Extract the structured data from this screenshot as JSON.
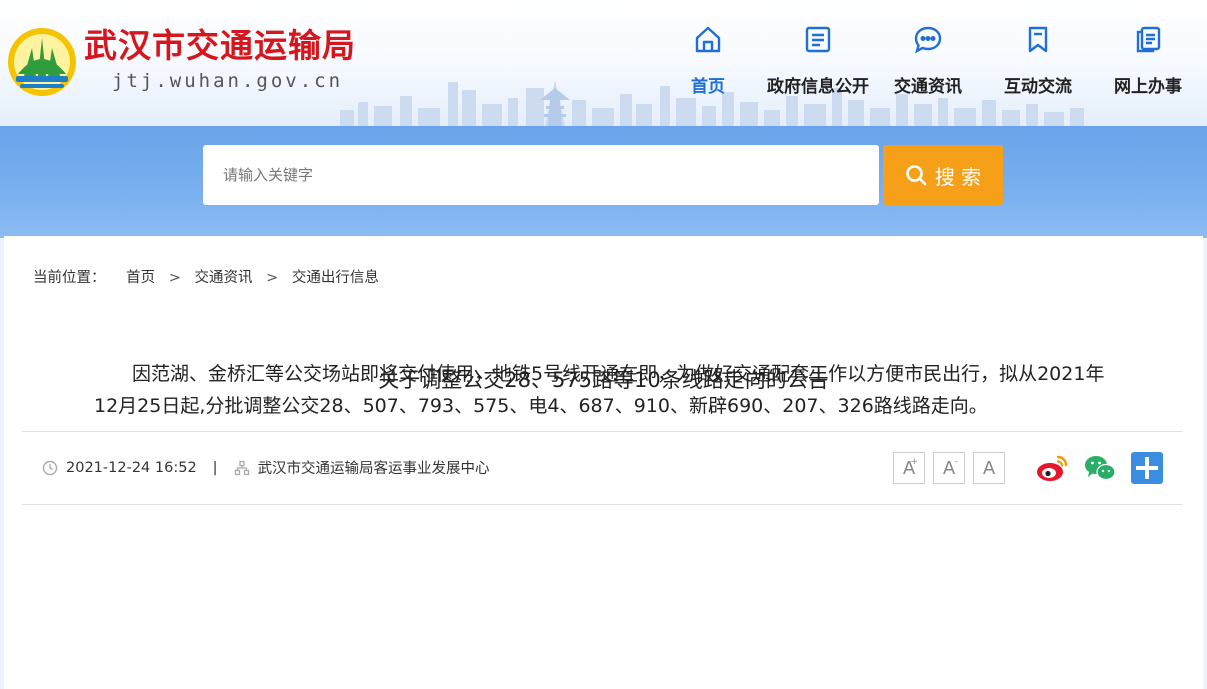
{
  "header": {
    "site_title": "武汉市交通运输局",
    "site_domain": "jtj.wuhan.gov.cn",
    "nav": [
      {
        "label": "首页",
        "icon": "home-icon",
        "active": true
      },
      {
        "label": "政府信息公开",
        "icon": "document-list-icon",
        "active": false
      },
      {
        "label": "交通资讯",
        "icon": "chat-bubble-icon",
        "active": false
      },
      {
        "label": "互动交流",
        "icon": "bookmark-icon",
        "active": false
      },
      {
        "label": "网上办事",
        "icon": "files-icon",
        "active": false
      }
    ]
  },
  "search": {
    "placeholder": "请输入关键字",
    "button_label": "搜 索"
  },
  "breadcrumb": {
    "prefix": "当前位置：",
    "items": [
      "首页",
      "交通资讯",
      "交通出行信息"
    ],
    "separator": ">"
  },
  "article": {
    "title": "关于调整公交28、575路等10条线路走向的公告",
    "date": "2021-12-24 16:52",
    "meta_separator": "|",
    "source": "武汉市交通运输局客运事业发展中心",
    "font_buttons": [
      "A+",
      "A-",
      "A"
    ],
    "body": "因范湖、金桥汇等公交场站即将交付使用，地铁5号线开通在即，为做好交通配套工作以方便市民出行，拟从2021年12月25日起,分批调整公交28、507、793、575、电4、687、910、新辟690、207、326路线路走向。"
  },
  "colors": {
    "brand_red": "#d6161c",
    "nav_active": "#1f6fd6",
    "search_button": "#f6a01a",
    "search_band": "#7ab0ef",
    "weibo": "#e6162d",
    "wechat": "#2aae67",
    "share_plus": "#3b8de0"
  }
}
